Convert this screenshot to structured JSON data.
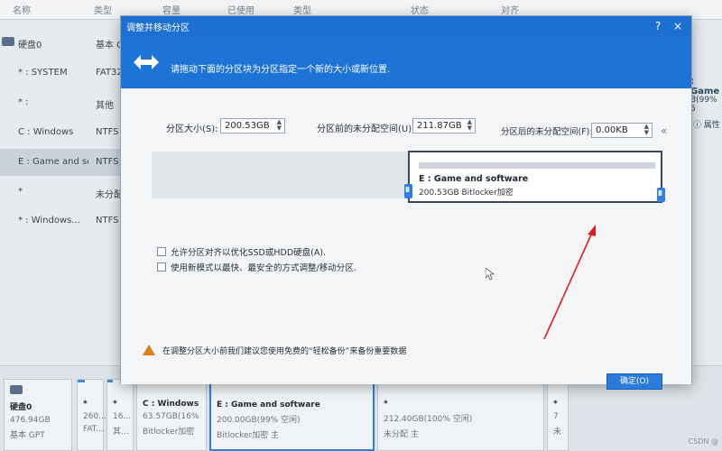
{
  "background": {
    "columns": [
      "名称",
      "类型",
      "容量",
      "已使用",
      "类型",
      "状态",
      "对齐"
    ],
    "rows": [
      {
        "name": "硬盘0",
        "type": "基本 GPT",
        "selected": false
      },
      {
        "name": "* : SYSTEM",
        "type": "FAT32",
        "selected": false
      },
      {
        "name": "* :",
        "type": "其他",
        "selected": false
      },
      {
        "name": "C : Windows",
        "type": "NTFS",
        "selected": false
      },
      {
        "name": "E : Game and software",
        "type": "NTFS",
        "selected": true
      },
      {
        "name": "*",
        "type": "未分配",
        "selected": false
      },
      {
        "name": "* : Windows...",
        "type": "NTFS",
        "selected": false
      }
    ],
    "right_panel": {
      "title": ": Game",
      "percent": "B(99% 5",
      "props": "属性"
    },
    "disk_tiles": [
      {
        "title": "硬盘0",
        "line1": "476.94GB",
        "line2": "基本 GPT"
      },
      {
        "title": "*",
        "line1": "260...",
        "line2": "FAT..."
      },
      {
        "title": "*",
        "line1": "16...",
        "line2": "其..."
      },
      {
        "title": "C : Windows",
        "line1": "63.57GB(16%",
        "line2": "Bitlocker加密"
      },
      {
        "title": "E : Game and software",
        "line1": "200.00GB(99% 空闲)",
        "line2": "Bitlocker加密 主"
      },
      {
        "title": "*",
        "line1": "212.40GB(100% 空闲)",
        "line2": "未分配 主"
      },
      {
        "title": "*",
        "line1": "7",
        "line2": "未"
      }
    ],
    "watermark": "CSDN @"
  },
  "dialog": {
    "title": "调整并移动分区",
    "help_label": "?",
    "close_label": "×",
    "banner_text": "请拖动下面的分区块为分区指定一个新的大小或新位置.",
    "size_label": "分区大小(S):",
    "size_value": "200.53GB",
    "before_label": "分区前的未分配空间(U):",
    "before_value": "211.87GB",
    "after_label": "分区后的未分配空间(F):",
    "after_value": "0.00KB",
    "collapse_label": "«",
    "partition": {
      "name": "E : Game and software",
      "info": "200.53GB Bitlocker加密"
    },
    "option_align": "允许分区对齐以优化SSD或HDD硬盘(A).",
    "option_fast": "使用新模式以最快、最安全的方式调整/移动分区.",
    "warning_text": "在调整分区大小前我们建议您使用免费的“轻松备份”来备份重要数据",
    "ok_label": "确定(O)"
  },
  "colors": {
    "titlebar": "#1d6fd1",
    "banner": "#1e74d6",
    "handle": "#2f7de0",
    "warning": "#e07b1a",
    "annotation_arrow": "#e02020"
  }
}
